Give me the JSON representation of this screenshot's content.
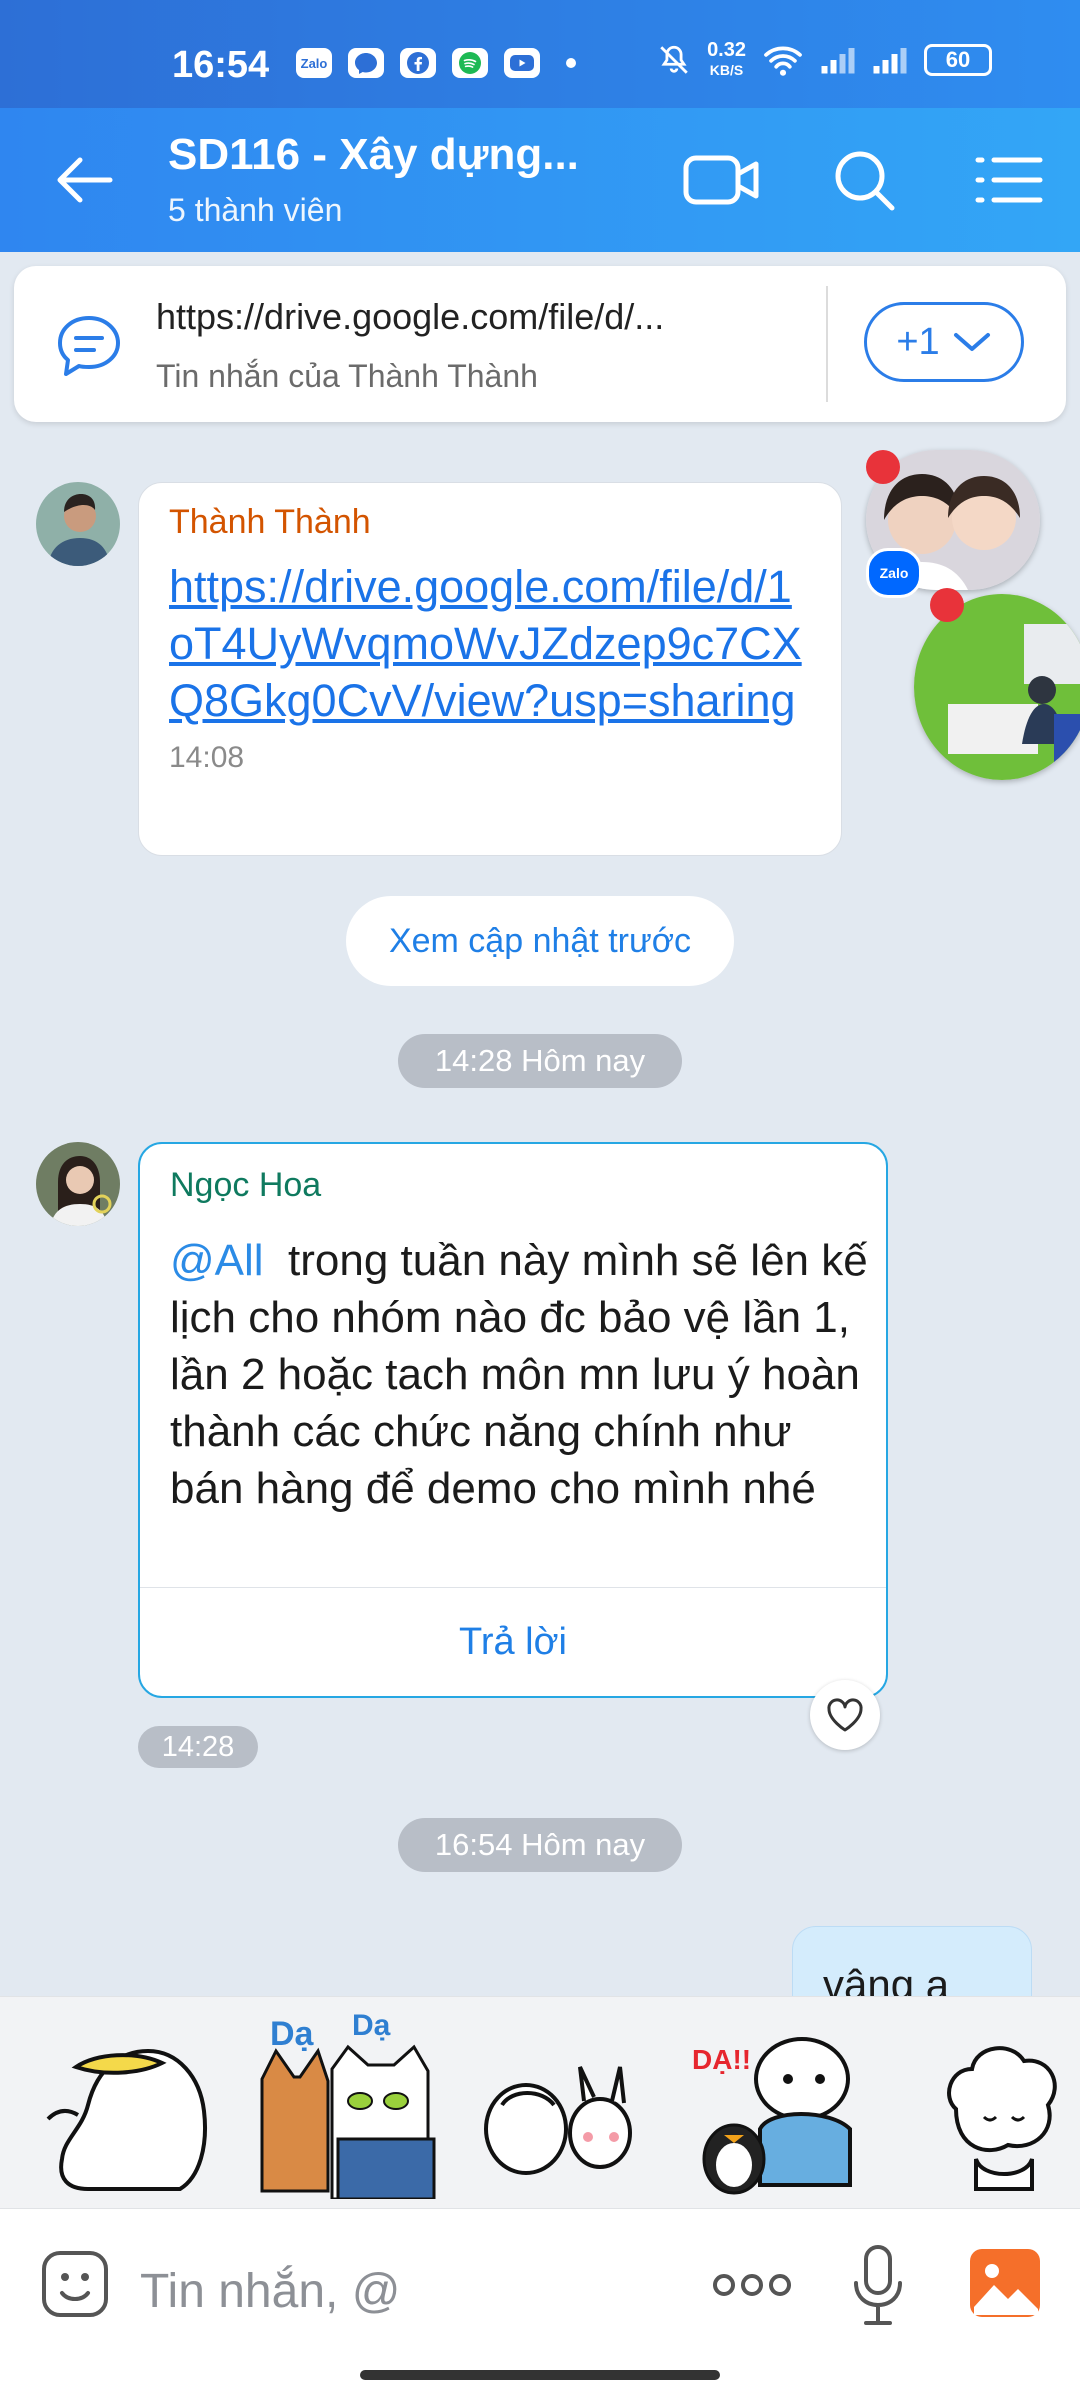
{
  "status_bar": {
    "time": "16:54",
    "apps": [
      "Zalo",
      "messenger-icon",
      "facebook-icon",
      "spotify-icon",
      "youtube-icon"
    ],
    "net_speed_value": "0.32",
    "net_speed_unit": "KB/S",
    "battery": "60"
  },
  "header": {
    "title": "SD116 - Xây dựng...",
    "subtitle": "5 thành viên",
    "icons": [
      "back-arrow-icon",
      "video-call-icon",
      "search-icon",
      "menu-icon"
    ]
  },
  "pinned": {
    "link": "https://drive.google.com/file/d/...",
    "sub": "Tin nhắn của Thành Thành",
    "more": "+1"
  },
  "messages": [
    {
      "sender": "Thành Thành",
      "sender_color": "#d35400",
      "link": "https://drive.google.com/file/d/1oT4UyWvqmoWvJZdzep9c7CXQ8Gkg0CvV/view?usp=sharing",
      "time": "14:08"
    },
    {
      "sender": "Ngọc Hoa",
      "sender_color": "#0f7a5f",
      "mention": "@All",
      "text": "trong tuần này mình sẽ lên kế lịch cho nhóm nào đc bảo vệ lần 1, lần 2 hoặc tach môn mn lưu ý hoàn thành các chức năng chính như bán hàng để demo cho mình nhé",
      "reply_label": "Trả lời",
      "time": "14:28"
    },
    {
      "text": "vâng ạ"
    }
  ],
  "prev_updates": "Xem cập nhật trước",
  "date_pills": [
    "14:28 Hôm nay",
    "16:54 Hôm nay"
  ],
  "chat_heads": {
    "badge": "Zalo"
  },
  "input": {
    "placeholder": "Tin nhắn, @"
  },
  "colors": {
    "header": "#2f8df0",
    "accent": "#1f7fe6",
    "background": "#e2e9f1"
  }
}
